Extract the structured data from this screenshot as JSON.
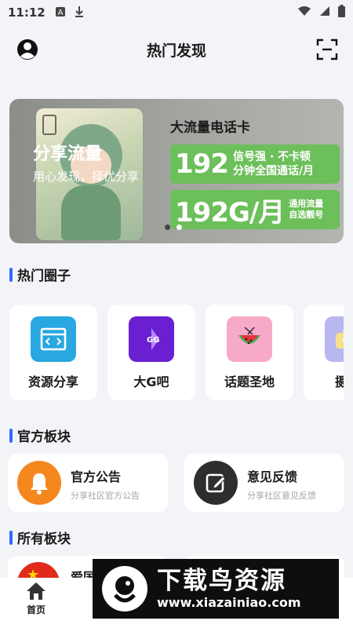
{
  "status_bar": {
    "time": "11:12"
  },
  "header": {
    "title": "热门发现"
  },
  "banner": {
    "share_title": "分享流量",
    "share_subtitle": "用心发现，择优分享",
    "card_title": "大流量电话卡",
    "line1_number": "192",
    "line1_text_top": "信号强 · 不卡顿",
    "line1_text_bottom": "分钟全国通话/月",
    "line2_number": "192G/月",
    "line2_text_top": "通用流量",
    "line2_text_bottom": "自选靓号",
    "slide_count": 2,
    "active_slide": 2
  },
  "hot_circles": {
    "title": "热门圈子",
    "items": [
      {
        "label": "资源分享",
        "icon": "code-window-icon",
        "color": "#29a7e0"
      },
      {
        "label": "大G吧",
        "icon": "gg-logo-icon",
        "color": "#6a1fd0"
      },
      {
        "label": "话题圣地",
        "icon": "watermelon-icon",
        "color": "#f7a9c8"
      },
      {
        "label": "摄影",
        "icon": "camera-icon",
        "color": "#b9b7f0"
      }
    ]
  },
  "official": {
    "title": "官方板块",
    "items": [
      {
        "title": "官方公告",
        "subtitle": "分享社区官方公告",
        "icon": "bell-icon",
        "color": "#f5871f"
      },
      {
        "title": "意见反馈",
        "subtitle": "分享社区意见反馈",
        "icon": "edit-icon",
        "color": "#2e2e2e"
      }
    ]
  },
  "all_sections": {
    "title": "所有板块",
    "items": [
      {
        "title": "爱国",
        "icon": "flag-icon"
      }
    ]
  },
  "bottom_nav": {
    "home_label": "首页"
  },
  "watermark": {
    "brand": "下载鸟资源",
    "url": "www.xiazainiao.com"
  }
}
